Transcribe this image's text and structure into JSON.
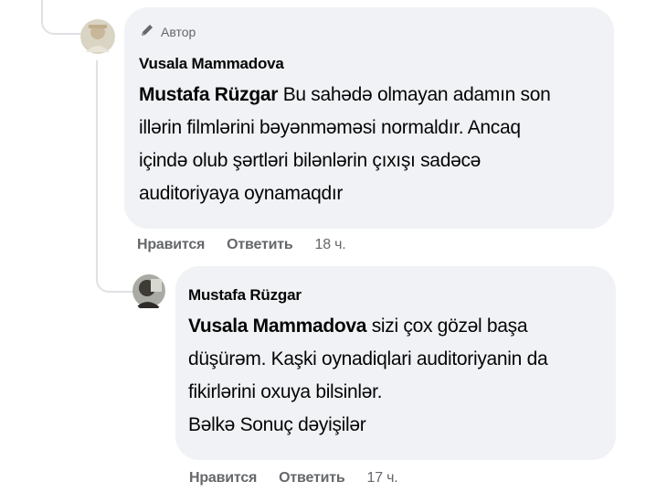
{
  "comment1": {
    "badge": "Автор",
    "author": "Vusala Mammadova",
    "mention": "Mustafa Rüzgar",
    "text": "Bu sahədə olmayan adamın son illərin filmlərini bəyənməməsi normaldır. Ancaq içində olub şərtləri bilənlərin çıxışı sadəcə auditoriyaya oynamaqdır",
    "lines_after_mention": [
      " Bu sahədə olmayan adamın son",
      "illərin filmlərini bəyənməməsi normaldır. Ancaq",
      "içində olub şərtləri bilənlərin çıxışı sadəcə",
      "auditoriyaya oynamaqdır"
    ],
    "like": "Нравится",
    "reply": "Ответить",
    "time": "18 ч."
  },
  "comment2": {
    "author": "Mustafa Rüzgar",
    "mention": "Vusala Mammadova",
    "lines_after_mention": [
      " sizi çox gözəl başa",
      "düşürəm. Kaşki oynadiqlari auditoriyanin da",
      "fikirlərini oxuya bilsinlər.",
      "Bəlkə Sonuç dəyişilər"
    ],
    "like": "Нравится",
    "reply": "Ответить",
    "time": "17 ч."
  },
  "icons": {
    "badge": "pencil-icon"
  }
}
